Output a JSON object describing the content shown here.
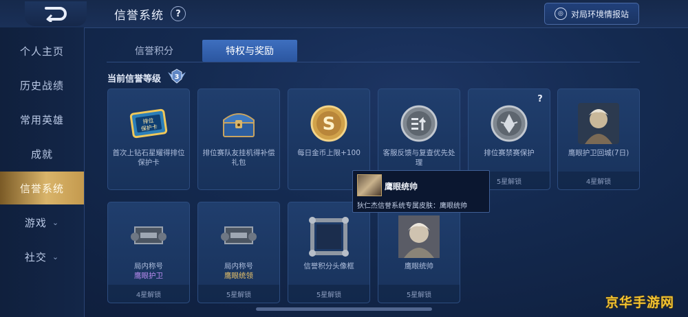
{
  "header": {
    "title": "信誉系统",
    "help_label": "?",
    "intel_button_label": "对局环境情报站"
  },
  "sidebar": {
    "items": [
      {
        "label": "个人主页"
      },
      {
        "label": "历史战绩"
      },
      {
        "label": "常用英雄"
      },
      {
        "label": "成就"
      },
      {
        "label": "信誉系统",
        "active": true
      },
      {
        "label": "游戏",
        "expandable": true
      },
      {
        "label": "社交",
        "expandable": true
      }
    ]
  },
  "tabs": [
    {
      "label": "信誉积分"
    },
    {
      "label": "特权与奖励",
      "active": true
    }
  ],
  "level": {
    "label": "当前信誉等级",
    "value": "3"
  },
  "cards": [
    {
      "icon": "rank-protect-card-icon",
      "desc": "首次上钻石星耀得排位保护卡",
      "sub": "",
      "unlock": ""
    },
    {
      "icon": "chest-icon",
      "desc": "排位赛队友挂机得补偿礼包",
      "sub": "",
      "unlock": ""
    },
    {
      "icon": "gold-coin-icon",
      "desc": "每日金币上限+100",
      "sub": "",
      "unlock": ""
    },
    {
      "icon": "feedback-icon",
      "desc": "客服反馈与复查优先处理",
      "sub": "",
      "unlock": ""
    },
    {
      "icon": "ban-protect-icon",
      "desc": "排位赛禁赛保护",
      "sub": "",
      "unlock": "5星解锁",
      "help": "?"
    },
    {
      "icon": "skin-portrait-icon",
      "desc": "鹰眼护卫回城(7日)",
      "sub": "",
      "unlock": "4星解锁"
    },
    {
      "icon": "title-scroll-icon",
      "desc": "局内称号",
      "sub": "鹰眼护卫",
      "sub_color": "purple",
      "unlock": "4星解锁"
    },
    {
      "icon": "title-scroll-icon",
      "desc": "局内称号",
      "sub": "鹰眼统领",
      "sub_color": "gold",
      "unlock": "5星解锁"
    },
    {
      "icon": "avatar-frame-icon",
      "desc": "信誉积分头像框",
      "sub": "",
      "unlock": "5星解锁"
    },
    {
      "icon": "skin-portrait-icon",
      "desc": "鹰眼统帅",
      "sub": "",
      "unlock": "5星解锁"
    }
  ],
  "tooltip": {
    "name": "鹰眼统帅",
    "desc": "狄仁杰信誉系统专属皮肤：鹰眼统帅"
  },
  "watermark": "京华手游网"
}
